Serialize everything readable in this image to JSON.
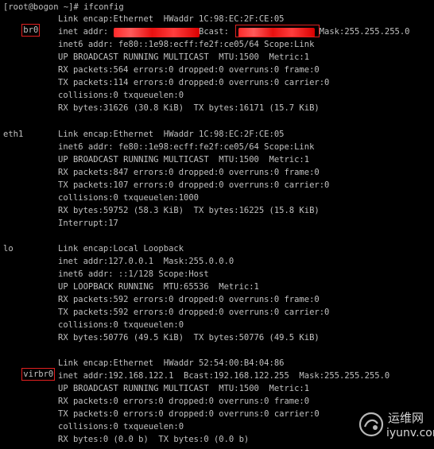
{
  "prompt_command": "[root@bogon ~]# ifconfig",
  "interfaces": {
    "br0": {
      "name": "br0",
      "lines": [
        "Link encap:Ethernet  HWaddr 1C:98:EC:2F:CE:05",
        "inet addr:                  Bcast:                  Mask:255.255.255.0",
        "inet6 addr: fe80::1e98:ecff:fe2f:ce05/64 Scope:Link",
        "UP BROADCAST RUNNING MULTICAST  MTU:1500  Metric:1",
        "RX packets:564 errors:0 dropped:0 overruns:0 frame:0",
        "TX packets:114 errors:0 dropped:0 overruns:0 carrier:0",
        "collisions:0 txqueuelen:0",
        "RX bytes:31626 (30.8 KiB)  TX bytes:16171 (15.7 KiB)"
      ]
    },
    "eth1": {
      "name": "eth1",
      "lines": [
        "Link encap:Ethernet  HWaddr 1C:98:EC:2F:CE:05",
        "inet6 addr: fe80::1e98:ecff:fe2f:ce05/64 Scope:Link",
        "UP BROADCAST RUNNING MULTICAST  MTU:1500  Metric:1",
        "RX packets:847 errors:0 dropped:0 overruns:0 frame:0",
        "TX packets:107 errors:0 dropped:0 overruns:0 carrier:0",
        "collisions:0 txqueuelen:1000",
        "RX bytes:59752 (58.3 KiB)  TX bytes:16225 (15.8 KiB)",
        "Interrupt:17"
      ]
    },
    "lo": {
      "name": "lo",
      "lines": [
        "Link encap:Local Loopback",
        "inet addr:127.0.0.1  Mask:255.0.0.0",
        "inet6 addr: ::1/128 Scope:Host",
        "UP LOOPBACK RUNNING  MTU:65536  Metric:1",
        "RX packets:592 errors:0 dropped:0 overruns:0 frame:0",
        "TX packets:592 errors:0 dropped:0 overruns:0 carrier:0",
        "collisions:0 txqueuelen:0",
        "RX bytes:50776 (49.5 KiB)  TX bytes:50776 (49.5 KiB)"
      ]
    },
    "virbr0": {
      "name": "virbr0",
      "lines": [
        "Link encap:Ethernet  HWaddr 52:54:00:B4:04:86",
        "inet addr:192.168.122.1  Bcast:192.168.122.255  Mask:255.255.255.0",
        "UP BROADCAST RUNNING MULTICAST  MTU:1500  Metric:1",
        "RX packets:0 errors:0 dropped:0 overruns:0 frame:0",
        "TX packets:0 errors:0 dropped:0 overruns:0 carrier:0",
        "collisions:0 txqueuelen:0",
        "RX bytes:0 (0.0 b)  TX bytes:0 (0.0 b)"
      ]
    }
  },
  "watermark": {
    "cn": "运维网",
    "url": "iyunv.com"
  },
  "colors": {
    "background": "#000000",
    "text": "#c0c0c0",
    "highlight_box": "#e02020",
    "watermark": "#d7d7d7"
  }
}
